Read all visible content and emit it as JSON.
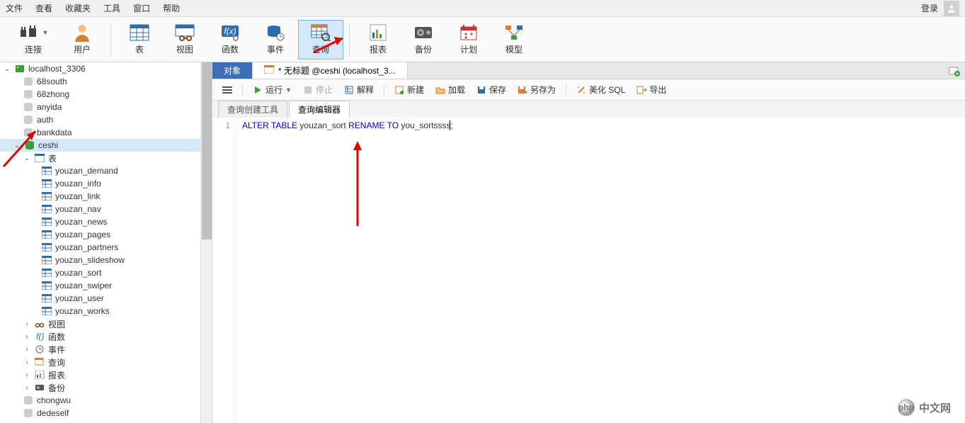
{
  "menu": {
    "items": [
      "文件",
      "查看",
      "收藏夹",
      "工具",
      "窗口",
      "帮助"
    ],
    "login": "登录"
  },
  "toolbar": {
    "connect": "连接",
    "user": "用户",
    "table": "表",
    "view": "视图",
    "func": "函数",
    "event": "事件",
    "query": "查询",
    "report": "报表",
    "backup": "备份",
    "schedule": "计划",
    "model": "模型"
  },
  "tree": {
    "root": "localhost_3306",
    "dbs_above": [
      "68south",
      "68zhong",
      "anyida",
      "auth",
      "bankdata"
    ],
    "selected_db": "ceshi",
    "tables_label": "表",
    "tables": [
      "youzan_demand",
      "youzan_info",
      "youzan_link",
      "youzan_nav",
      "youzan_news",
      "youzan_pages",
      "youzan_partners",
      "youzan_slideshow",
      "youzan_sort",
      "youzan_swiper",
      "youzan_user",
      "youzan_works"
    ],
    "nodes": [
      {
        "icon": "view",
        "label": "视图"
      },
      {
        "icon": "func",
        "label": "函数"
      },
      {
        "icon": "event",
        "label": "事件"
      },
      {
        "icon": "query",
        "label": "查询"
      },
      {
        "icon": "report",
        "label": "报表"
      },
      {
        "icon": "backup",
        "label": "备份"
      }
    ],
    "dbs_below": [
      "chongwu",
      "dedeself"
    ]
  },
  "tabs": {
    "object": "对象",
    "doc": "* 无标题 @ceshi (localhost_3..."
  },
  "actions": {
    "run": "运行",
    "stop": "停止",
    "explain": "解释",
    "new": "新建",
    "load": "加载",
    "save": "保存",
    "saveas": "另存为",
    "beautify": "美化 SQL",
    "export": "导出"
  },
  "subtabs": {
    "builder": "查询创建工具",
    "editor": "查询编辑器"
  },
  "code": {
    "line_no": "1",
    "tokens": [
      "ALTER",
      " ",
      "TABLE",
      " ",
      "youzan_sort",
      " ",
      "RENAME",
      " ",
      "TO",
      " ",
      "you_sortssss",
      ";"
    ]
  },
  "watermark": {
    "logo_text": "php",
    "text": "中文网"
  }
}
